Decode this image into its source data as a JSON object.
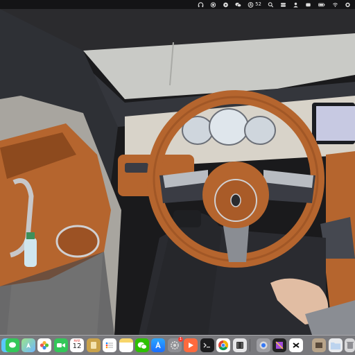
{
  "menubar": {
    "items": [
      {
        "icon": "headphones-icon"
      },
      {
        "icon": "record-icon"
      },
      {
        "icon": "play-circle-icon"
      },
      {
        "icon": "wechat-icon"
      },
      {
        "icon": "app-store-icon",
        "badge": "52"
      },
      {
        "icon": "search-icon"
      },
      {
        "icon": "control-center-icon"
      },
      {
        "icon": "user-icon"
      },
      {
        "icon": "wechat-tray-icon"
      },
      {
        "icon": "battery-icon"
      },
      {
        "icon": "wifi-icon"
      },
      {
        "icon": "siri-icon"
      }
    ]
  },
  "dock": {
    "apps": [
      {
        "name": "finder-icon"
      },
      {
        "name": "messages-icon"
      },
      {
        "name": "maps-icon"
      },
      {
        "name": "photos-icon"
      },
      {
        "name": "facetime-icon"
      },
      {
        "name": "calendar-icon",
        "month": "MAR",
        "day": "12"
      },
      {
        "name": "bookmarks-icon"
      },
      {
        "name": "reminders-icon"
      },
      {
        "name": "notes-icon"
      },
      {
        "name": "wechat-icon"
      },
      {
        "name": "app-store-icon"
      },
      {
        "name": "system-settings-icon",
        "badge": "1"
      },
      {
        "name": "infuse-icon"
      },
      {
        "name": "terminal-icon"
      },
      {
        "name": "chrome-icon"
      },
      {
        "name": "media-icon"
      },
      {
        "name": "quicktime-icon"
      },
      {
        "name": "final-cut-icon"
      },
      {
        "name": "capcut-icon"
      },
      {
        "name": "preview-icon"
      },
      {
        "name": "folder-icon"
      },
      {
        "name": "trash-icon"
      }
    ]
  },
  "colors": {
    "leather": "#b5652e",
    "dark_leather": "#8d4a1e",
    "dashboard": "#3a3c44",
    "menubar": "#141416",
    "dock": "#c8c8ce"
  }
}
